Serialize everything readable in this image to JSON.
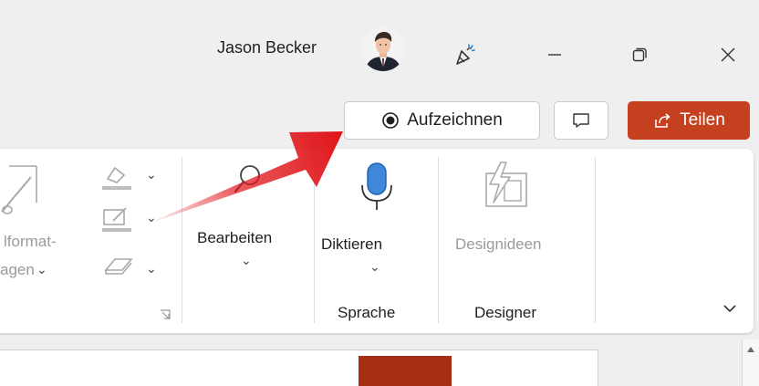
{
  "titlebar": {
    "user_name": "Jason Becker",
    "avatar_icon": "user-avatar",
    "celebrate_icon": "party-popper-icon",
    "minimize_icon": "minimize-icon",
    "restore_icon": "restore-icon",
    "close_icon": "close-icon"
  },
  "actions": {
    "record_label": "Aufzeichnen",
    "comment_icon": "comment-icon",
    "share_label": "Teilen",
    "share_color": "#c4401e"
  },
  "ribbon": {
    "format_partial_1": "lformat-",
    "format_partial_2": "agen",
    "edit_label": "Bearbeiten",
    "dictate_label": "Diktieren",
    "designideas_label": "Designideen",
    "group_speech": "Sprache",
    "group_designer": "Designer"
  },
  "colors": {
    "accent": "#c4401e",
    "mic": "#3f88d9",
    "arrow": "#e0161b"
  }
}
